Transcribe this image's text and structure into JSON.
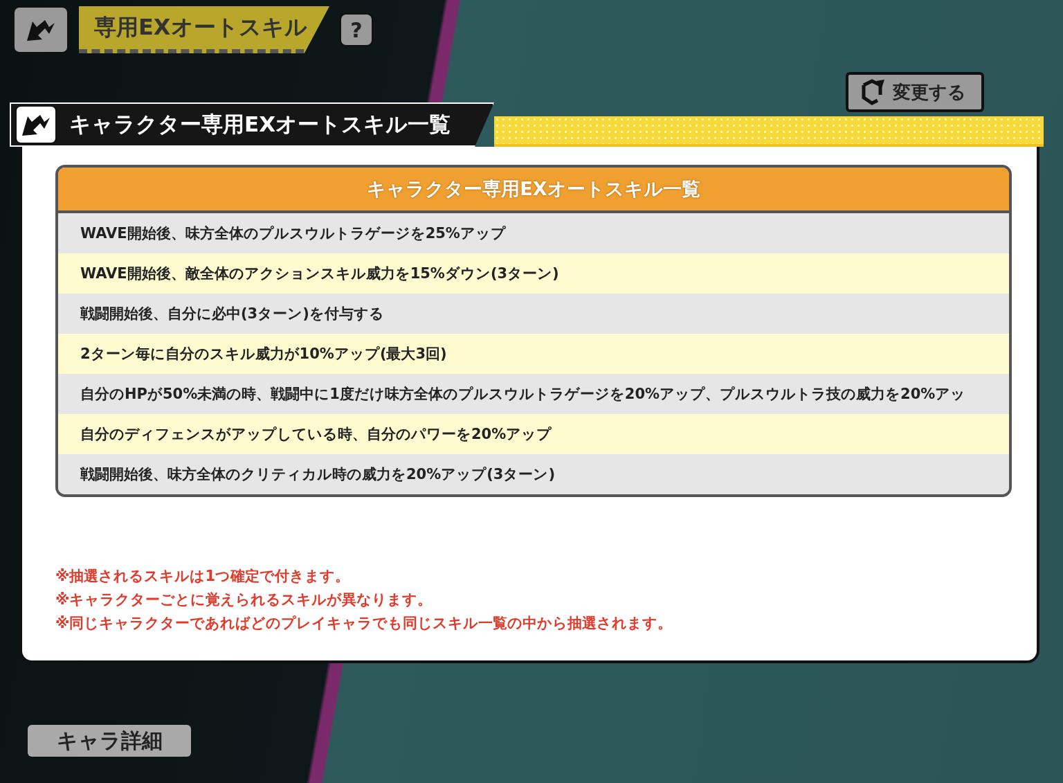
{
  "screen_header": {
    "title": "専用EXオートスキル",
    "help_label": "?"
  },
  "change_button": {
    "label": "変更する"
  },
  "dialog": {
    "title": "キャラクター専用EXオートスキル一覧",
    "table": {
      "heading": "キャラクター専用EXオートスキル一覧",
      "rows": [
        "WAVE開始後、味方全体のプルスウルトラゲージを25%アップ",
        "WAVE開始後、敵全体のアクションスキル威力を15%ダウン(3ターン)",
        "戦闘開始後、自分に必中(3ターン)を付与する",
        "2ターン毎に自分のスキル威力が10%アップ(最大3回)",
        "自分のHPが50%未満の時、戦闘中に1度だけ味方全体のプルスウルトラゲージを20%アップ、プルスウルトラ技の威力を20%アッ",
        "自分のディフェンスがアップしている時、自分のパワーを20%アップ",
        "戦闘開始後、味方全体のクリティカル時の威力を20%アップ(3ターン)"
      ]
    },
    "notes": [
      "※抽選されるスキルは1つ確定で付きます。",
      "※キャラクターごとに覚えられるスキルが異なります。",
      "※同じキャラクターであればどのプレイキャラでも同じスキル一覧の中から抽選されます。"
    ]
  },
  "detail_button": {
    "label": "キャラ詳細"
  }
}
